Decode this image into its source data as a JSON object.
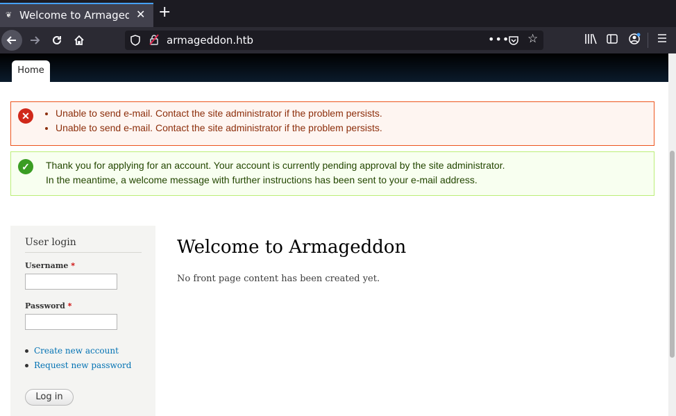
{
  "browser": {
    "tab_title": "Welcome to Armageddon",
    "url": "armageddon.htb",
    "new_tab": "+",
    "close_tab": "✕"
  },
  "site": {
    "nav_home": "Home"
  },
  "messages": {
    "errors": [
      "Unable to send e-mail. Contact the site administrator if the problem persists.",
      "Unable to send e-mail. Contact the site administrator if the problem persists."
    ],
    "status_line1": "Thank you for applying for an account. Your account is currently pending approval by the site administrator.",
    "status_line2": "In the meantime, a welcome message with further instructions has been sent to your e-mail address."
  },
  "login_block": {
    "title": "User login",
    "username_label": "Username",
    "password_label": "Password",
    "required_mark": "*",
    "links": [
      "Create new account",
      "Request new password"
    ],
    "submit_label": "Log in"
  },
  "main": {
    "title": "Welcome to Armageddon",
    "body": "No front page content has been created yet."
  }
}
